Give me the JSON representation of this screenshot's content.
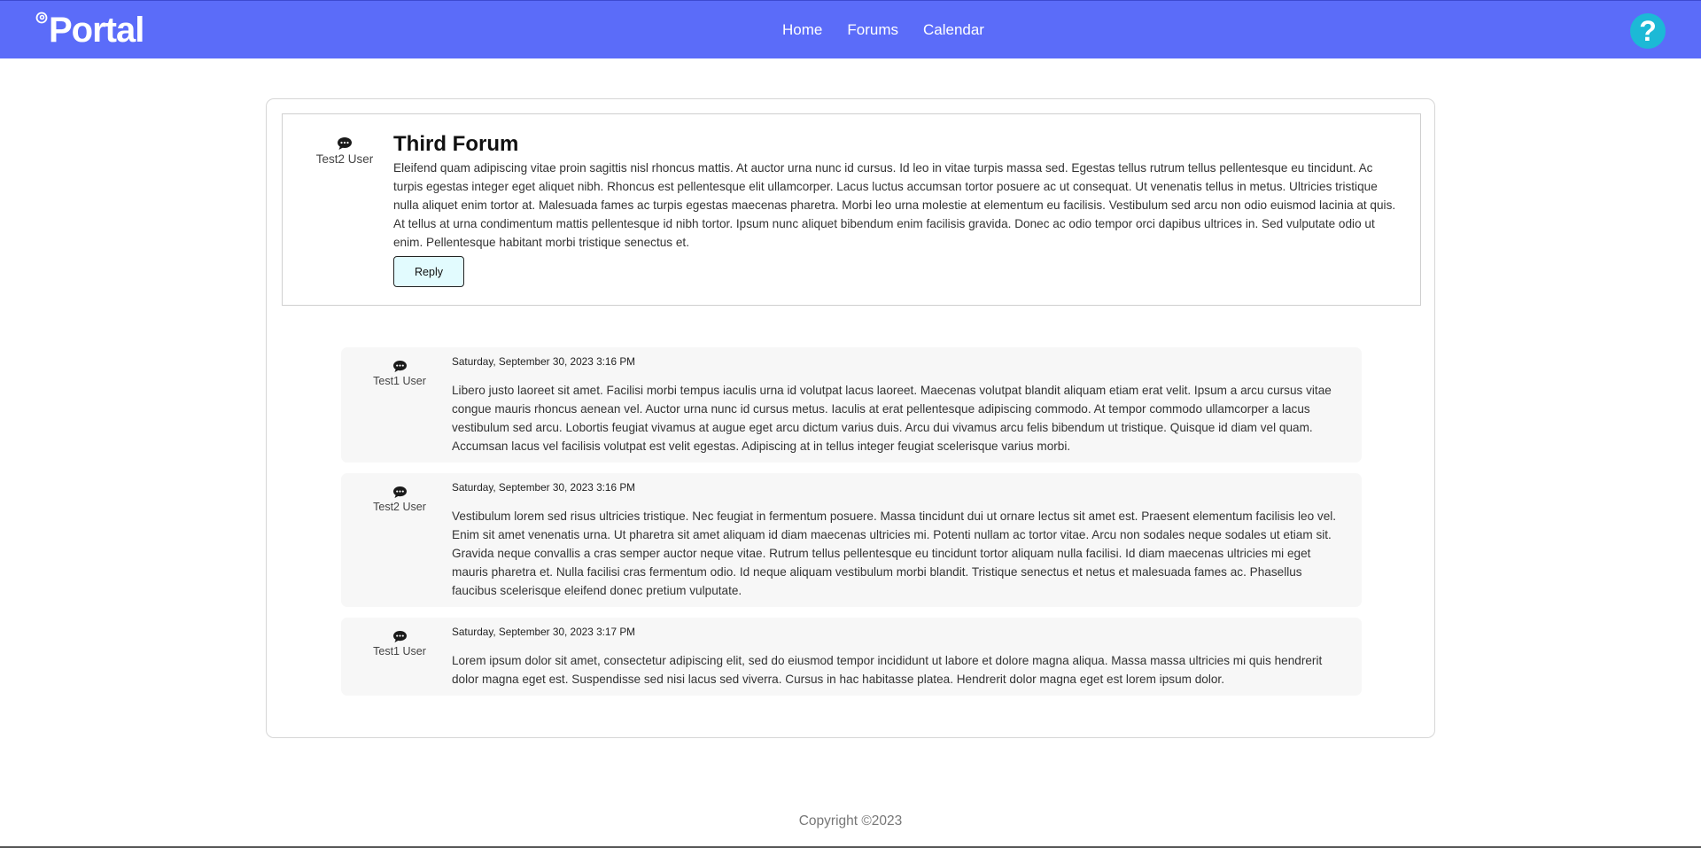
{
  "header": {
    "brand": "Portal",
    "nav": [
      "Home",
      "Forums",
      "Calendar"
    ],
    "help": "?"
  },
  "forum": {
    "author": "Test2 User",
    "title": "Third Forum",
    "body": "Eleifend quam adipiscing vitae proin sagittis nisl rhoncus mattis. At auctor urna nunc id cursus. Id leo in vitae turpis massa sed. Egestas tellus rutrum tellus pellentesque eu tincidunt. Ac turpis egestas integer eget aliquet nibh. Rhoncus est pellentesque elit ullamcorper. Lacus luctus accumsan tortor posuere ac ut consequat. Ut venenatis tellus in metus. Ultricies tristique nulla aliquet enim tortor at. Malesuada fames ac turpis egestas maecenas pharetra. Morbi leo urna molestie at elementum eu facilisis. Vestibulum sed arcu non odio euismod lacinia at quis. At tellus at urna condimentum mattis pellentesque id nibh tortor. Ipsum nunc aliquet bibendum enim facilisis gravida. Donec ac odio tempor orci dapibus ultrices in. Sed vulputate odio ut enim. Pellentesque habitant morbi tristique senectus et.",
    "reply_label": "Reply"
  },
  "posts": [
    {
      "author": "Test1 User",
      "date": "Saturday, September 30, 2023 3:16 PM",
      "body": "Libero justo laoreet sit amet. Facilisi morbi tempus iaculis urna id volutpat lacus laoreet. Maecenas volutpat blandit aliquam etiam erat velit. Ipsum a arcu cursus vitae congue mauris rhoncus aenean vel. Auctor urna nunc id cursus metus. Iaculis at erat pellentesque adipiscing commodo. At tempor commodo ullamcorper a lacus vestibulum sed arcu. Lobortis feugiat vivamus at augue eget arcu dictum varius duis. Arcu dui vivamus arcu felis bibendum ut tristique. Quisque id diam vel quam. Accumsan lacus vel facilisis volutpat est velit egestas. Adipiscing at in tellus integer feugiat scelerisque varius morbi."
    },
    {
      "author": "Test2 User",
      "date": "Saturday, September 30, 2023 3:16 PM",
      "body": "Vestibulum lorem sed risus ultricies tristique. Nec feugiat in fermentum posuere. Massa tincidunt dui ut ornare lectus sit amet est. Praesent elementum facilisis leo vel. Enim sit amet venenatis urna. Ut pharetra sit amet aliquam id diam maecenas ultricies mi. Potenti nullam ac tortor vitae. Arcu non sodales neque sodales ut etiam sit. Gravida neque convallis a cras semper auctor neque vitae. Rutrum tellus pellentesque eu tincidunt tortor aliquam nulla facilisi. Id diam maecenas ultricies mi eget mauris pharetra et. Nulla facilisi cras fermentum odio. Id neque aliquam vestibulum morbi blandit. Tristique senectus et netus et malesuada fames ac. Phasellus faucibus scelerisque eleifend donec pretium vulputate."
    },
    {
      "author": "Test1 User",
      "date": "Saturday, September 30, 2023 3:17 PM",
      "body": "Lorem ipsum dolor sit amet, consectetur adipiscing elit, sed do eiusmod tempor incididunt ut labore et dolore magna aliqua. Massa massa ultricies mi quis hendrerit dolor magna eget est. Suspendisse sed nisi lacus sed viverra. Cursus in hac habitasse platea. Hendrerit dolor magna eget est lorem ipsum dolor."
    }
  ],
  "footer": {
    "copyright": "Copyright ©2023"
  },
  "colors": {
    "header_bg": "#5b6cf9",
    "help_bg": "#1cb9d6",
    "reply_bg": "#e2fbfe",
    "post_bg": "#f7f7f7"
  },
  "icons": {
    "brand": "swirl-icon",
    "author": "chat-bubble-icon"
  }
}
